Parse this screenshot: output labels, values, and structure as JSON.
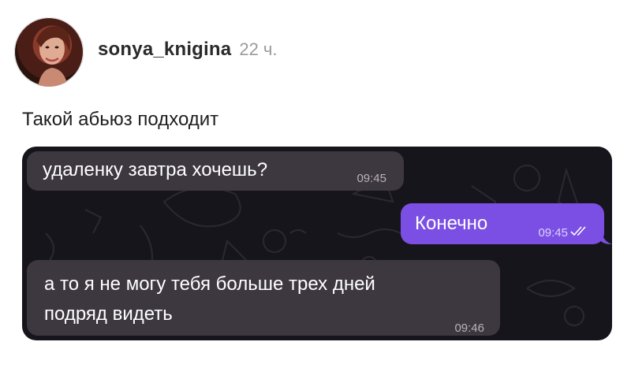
{
  "post": {
    "username": "sonya_knigina",
    "time": "22 ч.",
    "caption": "Такой абьюз подходит"
  },
  "chat": {
    "messages": [
      {
        "direction": "incoming",
        "text": "удаленку завтра хочешь?",
        "time": "09:45"
      },
      {
        "direction": "outgoing",
        "text": "Конечно",
        "time": "09:45",
        "status_icon": "double-check-icon"
      },
      {
        "direction": "incoming",
        "text_line1": "а то я не могу тебя больше трех дней",
        "text_line2": "подряд видеть",
        "time": "09:46"
      }
    ]
  },
  "colors": {
    "chat_background": "#17151c",
    "incoming_bubble": "#3d3740",
    "outgoing_bubble": "#7b4fe3",
    "username": "#2a2a2a",
    "timestamp": "#9a9a9a"
  }
}
